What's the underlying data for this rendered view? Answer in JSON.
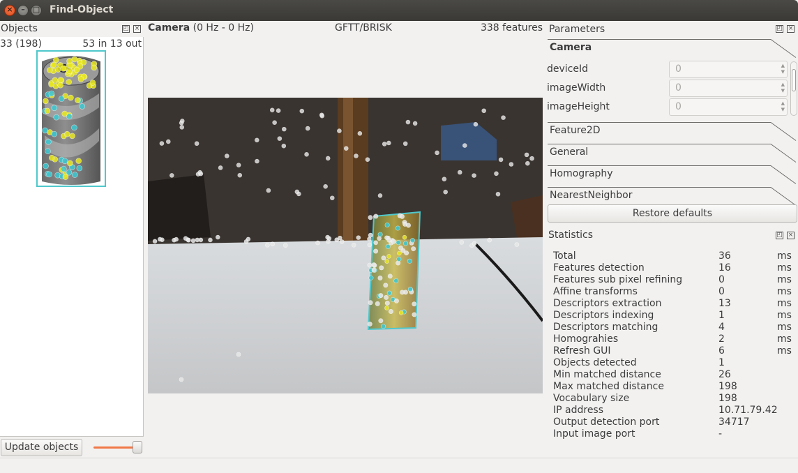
{
  "window": {
    "title": "Find-Object",
    "close_glyph": "×",
    "min_glyph": "–",
    "max_glyph": "□"
  },
  "objects": {
    "title": "Objects",
    "count": "33 (198)",
    "inout": "53 in 13 out",
    "update_label": "Update objects",
    "slider_level": 0.85
  },
  "camera": {
    "title": "Camera",
    "rate": "(0 Hz - 0 Hz)",
    "method": "GFTT/BRISK",
    "features": "338 features"
  },
  "parameters": {
    "title": "Parameters",
    "tabs": [
      "Camera",
      "Feature2D",
      "General",
      "Homography",
      "NearestNeighbor"
    ],
    "rows": [
      {
        "label": "deviceId",
        "value": "0"
      },
      {
        "label": "imageWidth",
        "value": "0"
      },
      {
        "label": "imageHeight",
        "value": "0"
      }
    ],
    "restore_label": "Restore defaults"
  },
  "statistics": {
    "title": "Statistics",
    "rows": [
      {
        "name": "Total",
        "value": "36",
        "unit": "ms"
      },
      {
        "name": "Features detection",
        "value": "16",
        "unit": "ms"
      },
      {
        "name": "Features sub pixel refining",
        "value": "0",
        "unit": "ms"
      },
      {
        "name": "Affine transforms",
        "value": "0",
        "unit": "ms"
      },
      {
        "name": "Descriptors extraction",
        "value": "13",
        "unit": "ms"
      },
      {
        "name": "Descriptors indexing",
        "value": "1",
        "unit": "ms"
      },
      {
        "name": "Descriptors matching",
        "value": "4",
        "unit": "ms"
      },
      {
        "name": "Homograhies",
        "value": "2",
        "unit": "ms"
      },
      {
        "name": "Refresh GUI",
        "value": "6",
        "unit": "ms"
      },
      {
        "name": "Objects detected",
        "value": "1",
        "unit": ""
      },
      {
        "name": "Min matched distance",
        "value": "26",
        "unit": ""
      },
      {
        "name": "Max matched distance",
        "value": "198",
        "unit": ""
      },
      {
        "name": "Vocabulary size",
        "value": "198",
        "unit": ""
      },
      {
        "name": "IP address",
        "value": "10.71.79.42",
        "unit": ""
      },
      {
        "name": "Output detection port",
        "value": "34717",
        "unit": ""
      },
      {
        "name": "Input image port",
        "value": "-",
        "unit": ""
      }
    ]
  },
  "colors": {
    "accent": "#f07746",
    "detection_box": "#4fc8cc",
    "feature_yellow": "#e8e61e",
    "feature_cyan": "#3cc8d0",
    "feature_white": "#e8e8e8"
  }
}
